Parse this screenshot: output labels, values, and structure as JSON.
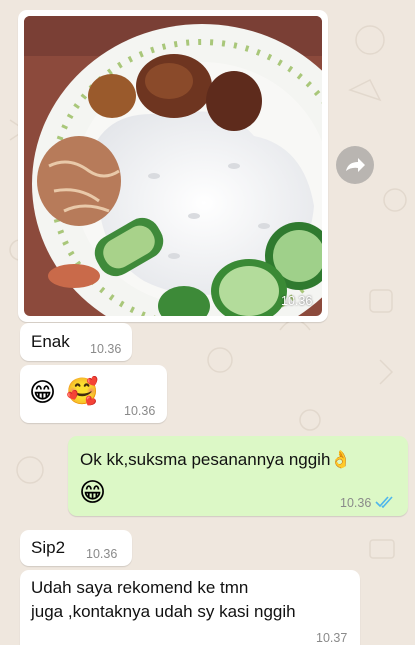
{
  "messages": [
    {
      "type": "image",
      "direction": "in",
      "time": "10.36",
      "photo": "plate of white rice with fried chicken, fried shallot topping and sliced cucumber"
    },
    {
      "type": "text",
      "direction": "in",
      "text": "Enak",
      "time": "10.36"
    },
    {
      "type": "emoji",
      "direction": "in",
      "emojis": [
        "😁",
        "🥰"
      ],
      "time": "10.36"
    },
    {
      "type": "text",
      "direction": "out",
      "text": "Ok kk,suksma pesanannya nggih👌",
      "emoji": "😁",
      "time": "10.36",
      "status": "read"
    },
    {
      "type": "text",
      "direction": "in",
      "text": "Sip2",
      "time": "10.36"
    },
    {
      "type": "text",
      "direction": "in",
      "text_line1": "Udah saya rekomend ke tmn",
      "text_line2": "juga ,kontaknya udah sy kasi nggih",
      "time": "10.37"
    }
  ],
  "colors": {
    "wallpaper": "#efe7de",
    "incoming": "#ffffff",
    "outgoing": "#dcf8c6",
    "read_ticks": "#4fb6ec"
  },
  "icons": {
    "forward": "forward-icon",
    "read_status": "double-check-icon"
  }
}
